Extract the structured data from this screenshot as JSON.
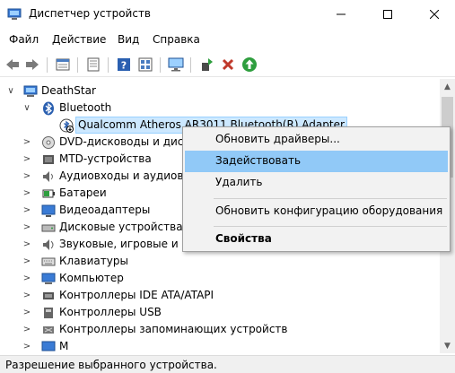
{
  "window": {
    "title": "Диспетчер устройств"
  },
  "menu": [
    "Файл",
    "Действие",
    "Вид",
    "Справка"
  ],
  "toolbar": {
    "icons": [
      "back-arrow-icon",
      "forward-arrow-icon",
      "properties-icon",
      "document-icon",
      "help-icon",
      "view-icon",
      "monitor-icon",
      "update-driver-icon",
      "uninstall-x-icon",
      "enable-green-arrow-icon"
    ],
    "accent": {
      "uninstall": "#c0392b",
      "enable": "#2e9e3e"
    }
  },
  "tree": {
    "root": "DeathStar",
    "bluetooth": "Bluetooth",
    "device": "Qualcomm Atheros AR3011 Bluetooth(R) Adapter",
    "categories": [
      "DVD-дисководы и дисководы компакт-дисков",
      "MTD-устройства",
      "Аудиовходы и аудиовыходы",
      "Батареи",
      "Видеоадаптеры",
      "Дисковые устройства",
      "Звуковые, игровые и видеоустройства",
      "Клавиатуры",
      "Компьютер",
      "Контроллеры IDE ATA/ATAPI",
      "Контроллеры USB",
      "Контроллеры запоминающих устройств",
      "Мониторы"
    ],
    "visible_categories": [
      "DVD-дисководы и диск",
      "MTD-устройства",
      "Аудиовходы и аудиовых",
      "Батареи",
      "Видеоадаптеры",
      "Дисковые устройства",
      "Звуковые, игровые и в",
      "Клавиатуры",
      "Компьютер",
      "Контроллеры IDE ATA/ATAPI",
      "Контроллеры USB",
      "Контроллеры запоминающих устройств",
      "М"
    ]
  },
  "context_menu": {
    "items": [
      "Обновить драйверы...",
      "Задействовать",
      "Удалить",
      "Обновить конфигурацию оборудования",
      "Свойства"
    ]
  },
  "status": {
    "text": "Разрешение выбранного устройства."
  }
}
